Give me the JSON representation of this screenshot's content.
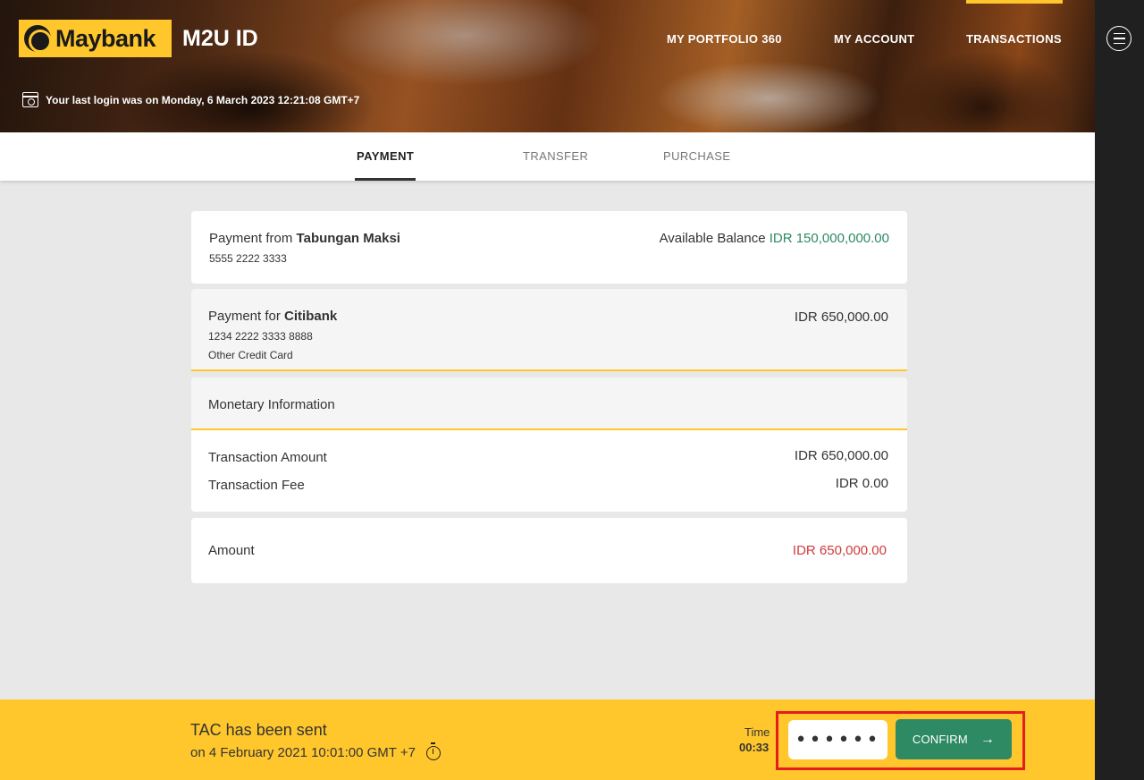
{
  "header": {
    "logo_text": "Maybank",
    "brand_title": "M2U ID",
    "nav": [
      "MY PORTFOLIO 360",
      "MY ACCOUNT",
      "TRANSACTIONS"
    ],
    "last_login": "Your last login was on Monday, 6 March 2023 12:21:08 GMT+7"
  },
  "tabs": [
    {
      "label": "PAYMENT",
      "active": true
    },
    {
      "label": "TRANSFER",
      "active": false
    },
    {
      "label": "PURCHASE",
      "active": false
    }
  ],
  "payment_from": {
    "label": "Payment from",
    "account_name": "Tabungan Maksi",
    "account_number": "5555 2222 3333",
    "balance_label": "Available Balance",
    "balance_value": "IDR 150,000,000.00"
  },
  "payment_for": {
    "label": "Payment for",
    "payee": "Citibank",
    "card_number": "1234 2222 3333 8888",
    "card_type": "Other Credit Card",
    "amount": "IDR 650,000.00"
  },
  "monetary": {
    "title": "Monetary Information",
    "rows": [
      {
        "label": "Transaction Amount",
        "value": "IDR 650,000.00"
      },
      {
        "label": "Transaction Fee",
        "value": "IDR 0.00"
      }
    ]
  },
  "total": {
    "label": "Amount",
    "value": "IDR 650,000.00"
  },
  "footer": {
    "tac_title": "TAC has been sent",
    "tac_sub": "on 4 February 2021 10:01:00 GMT +7",
    "time_label": "Time",
    "time_value": "00:33",
    "tac_input_value": "••••••",
    "confirm_label": "CONFIRM"
  },
  "colors": {
    "brand_yellow": "#ffc72c",
    "confirm_green": "#2e8a63",
    "balance_green": "#2e8a63",
    "amount_red": "#d03b3b",
    "highlight_red": "#e41e1e"
  },
  "icons": [
    "calendar-icon",
    "menu-icon",
    "stopwatch-icon",
    "arrow-right-icon"
  ]
}
